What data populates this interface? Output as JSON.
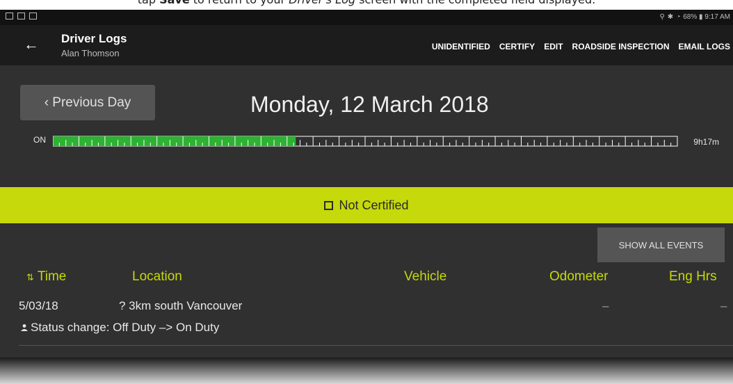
{
  "caption": {
    "pre": "tap ",
    "bold": "Save",
    "mid": " to return to your ",
    "ital": "Driver's Log",
    "post": " screen with the completed field displayed."
  },
  "status_bar": {
    "right": "68% ▮ 9:17 AM"
  },
  "toolbar": {
    "title": "Driver Logs",
    "subtitle": "Alan Thomson",
    "actions": [
      "UNIDENTIFIED",
      "CERTIFY",
      "EDIT",
      "ROADSIDE INSPECTION",
      "EMAIL LOGS"
    ]
  },
  "nav": {
    "prev_day": "‹ Previous Day"
  },
  "date": "Monday, 12 March 2018",
  "timeline": {
    "label": "ON",
    "total": "9h17m",
    "on_duty_fraction": 0.389,
    "colors": {
      "on": "#2db232",
      "rest": "#ffffff"
    }
  },
  "certification": {
    "status": "Not Certified",
    "bar_color": "#c6d90a"
  },
  "events": {
    "show_all": "SHOW ALL EVENTS",
    "columns": {
      "time": "Time",
      "location": "Location",
      "vehicle": "Vehicle",
      "odometer": "Odometer",
      "eng_hrs": "Eng Hrs"
    },
    "rows": [
      {
        "date": "5/03/18",
        "location": "? 3km south Vancouver",
        "odometer": "–",
        "eng_hrs": "–",
        "status": "Status change: Off Duty –> On Duty"
      }
    ]
  },
  "icons": {
    "back": "arrow-left-icon",
    "sort": "sort-icon",
    "user": "person-icon",
    "checkbox": "checkbox-empty-icon"
  }
}
